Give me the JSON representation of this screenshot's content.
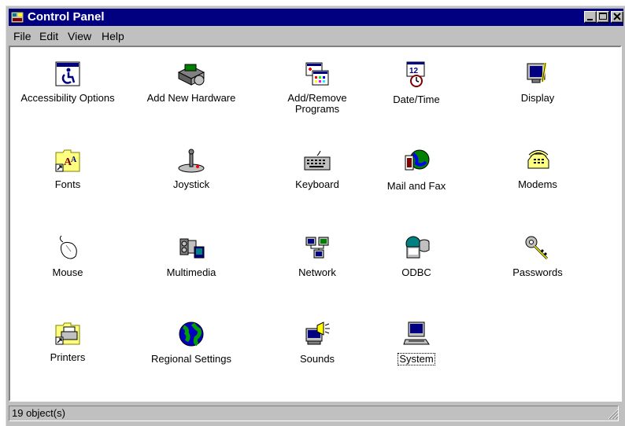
{
  "window": {
    "title": "Control Panel"
  },
  "menu": [
    {
      "label": "File"
    },
    {
      "label": "Edit"
    },
    {
      "label": "View"
    },
    {
      "label": "Help"
    }
  ],
  "items": [
    {
      "label": "Accessibility Options",
      "icon": "accessibility-icon"
    },
    {
      "label": "Add New Hardware",
      "icon": "add-hardware-icon"
    },
    {
      "label": "Add/Remove Programs",
      "icon": "add-remove-programs-icon"
    },
    {
      "label": "Date/Time",
      "icon": "date-time-icon"
    },
    {
      "label": "Display",
      "icon": "display-icon"
    },
    {
      "label": "Fonts",
      "icon": "fonts-icon"
    },
    {
      "label": "Joystick",
      "icon": "joystick-icon"
    },
    {
      "label": "Keyboard",
      "icon": "keyboard-icon"
    },
    {
      "label": "Mail and Fax",
      "icon": "mail-fax-icon"
    },
    {
      "label": "Modems",
      "icon": "modem-icon"
    },
    {
      "label": "Mouse",
      "icon": "mouse-icon"
    },
    {
      "label": "Multimedia",
      "icon": "multimedia-icon"
    },
    {
      "label": "Network",
      "icon": "network-icon"
    },
    {
      "label": "ODBC",
      "icon": "odbc-icon"
    },
    {
      "label": "Passwords",
      "icon": "passwords-icon"
    },
    {
      "label": "Printers",
      "icon": "printers-icon"
    },
    {
      "label": "Regional Settings",
      "icon": "regional-settings-icon"
    },
    {
      "label": "Sounds",
      "icon": "sounds-icon"
    },
    {
      "label": "System",
      "icon": "system-icon"
    }
  ],
  "status": {
    "text": "19 object(s)"
  },
  "colors": {
    "titlebar": "#000080",
    "face": "#c0c0c0"
  }
}
